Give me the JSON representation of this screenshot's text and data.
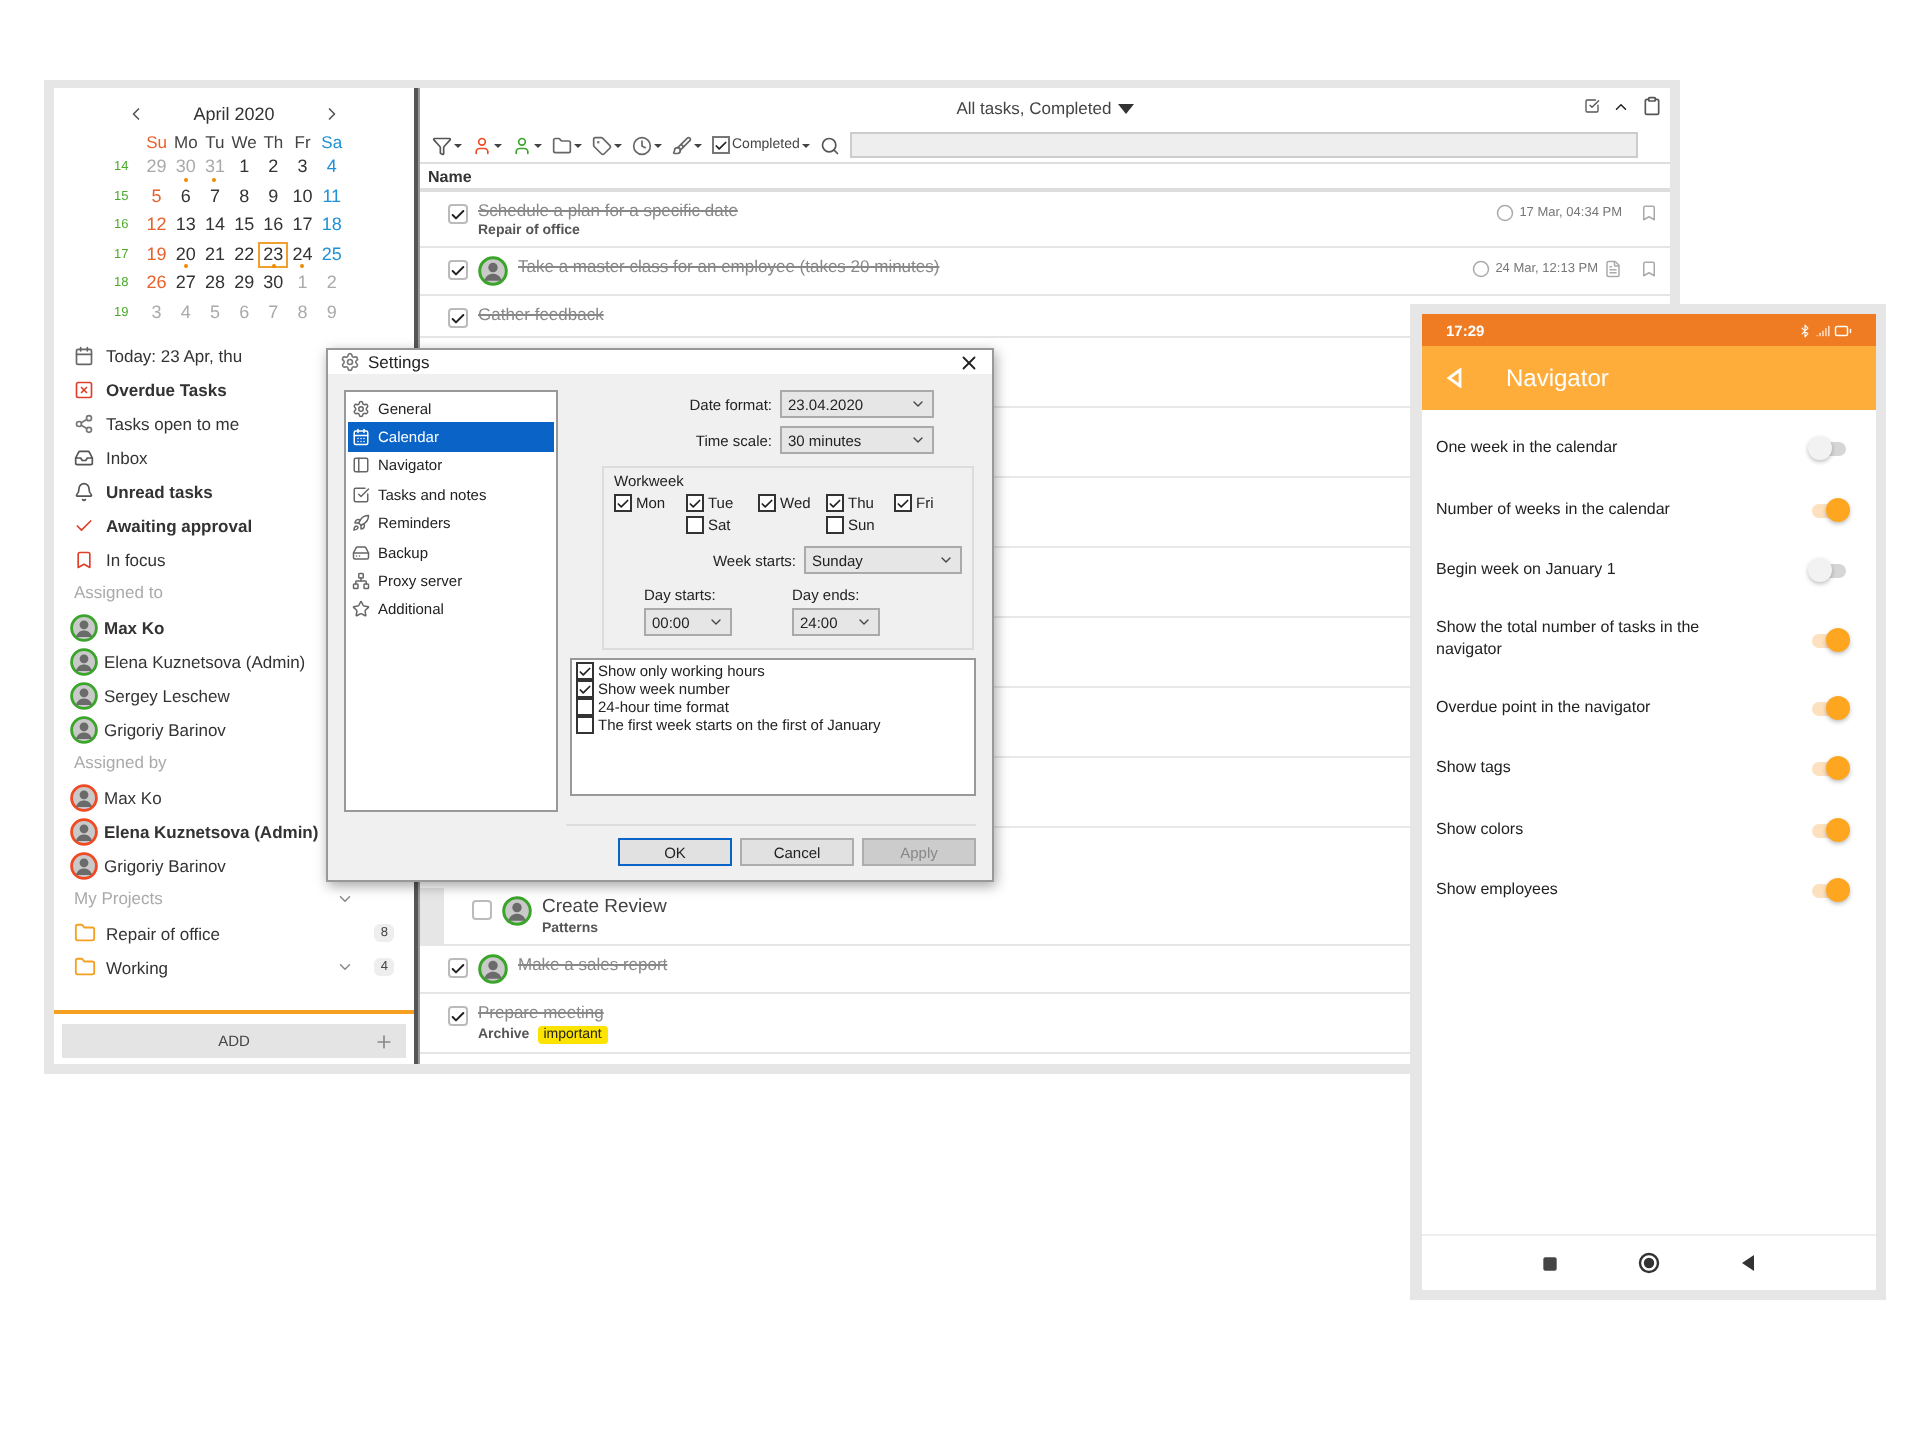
{
  "calendar": {
    "month": "April 2020",
    "weekdays": [
      "Su",
      "Mo",
      "Tu",
      "We",
      "Th",
      "Fr",
      "Sa"
    ],
    "weeks": [
      {
        "number": "14",
        "days": [
          {
            "d": "29",
            "muted": true,
            "marked": false,
            "selected": false
          },
          {
            "d": "30",
            "muted": true,
            "marked": true,
            "selected": false
          },
          {
            "d": "31",
            "muted": true,
            "marked": true,
            "selected": false
          },
          {
            "d": "1",
            "muted": false,
            "marked": false,
            "selected": false
          },
          {
            "d": "2",
            "muted": false,
            "marked": false,
            "selected": false
          },
          {
            "d": "3",
            "muted": false,
            "marked": false,
            "selected": false
          },
          {
            "d": "4",
            "muted": false,
            "marked": false,
            "selected": false
          }
        ]
      },
      {
        "number": "15",
        "days": [
          {
            "d": "5",
            "muted": false,
            "marked": false,
            "selected": false
          },
          {
            "d": "6",
            "muted": false,
            "marked": false,
            "selected": false
          },
          {
            "d": "7",
            "muted": false,
            "marked": false,
            "selected": false
          },
          {
            "d": "8",
            "muted": false,
            "marked": false,
            "selected": false
          },
          {
            "d": "9",
            "muted": false,
            "marked": false,
            "selected": false
          },
          {
            "d": "10",
            "muted": false,
            "marked": false,
            "selected": false
          },
          {
            "d": "11",
            "muted": false,
            "marked": false,
            "selected": false
          }
        ]
      },
      {
        "number": "16",
        "days": [
          {
            "d": "12",
            "muted": false,
            "marked": false,
            "selected": false
          },
          {
            "d": "13",
            "muted": false,
            "marked": false,
            "selected": false
          },
          {
            "d": "14",
            "muted": false,
            "marked": false,
            "selected": false
          },
          {
            "d": "15",
            "muted": false,
            "marked": false,
            "selected": false
          },
          {
            "d": "16",
            "muted": false,
            "marked": false,
            "selected": false
          },
          {
            "d": "17",
            "muted": false,
            "marked": false,
            "selected": false
          },
          {
            "d": "18",
            "muted": false,
            "marked": false,
            "selected": false
          }
        ]
      },
      {
        "number": "17",
        "days": [
          {
            "d": "19",
            "muted": false,
            "marked": false,
            "selected": false
          },
          {
            "d": "20",
            "muted": false,
            "marked": true,
            "selected": false
          },
          {
            "d": "21",
            "muted": false,
            "marked": false,
            "selected": false
          },
          {
            "d": "22",
            "muted": false,
            "marked": false,
            "selected": false
          },
          {
            "d": "23",
            "muted": false,
            "marked": true,
            "selected": true
          },
          {
            "d": "24",
            "muted": false,
            "marked": true,
            "selected": false
          },
          {
            "d": "25",
            "muted": false,
            "marked": false,
            "selected": false
          }
        ]
      },
      {
        "number": "18",
        "days": [
          {
            "d": "26",
            "muted": false,
            "marked": false,
            "selected": false
          },
          {
            "d": "27",
            "muted": false,
            "marked": false,
            "selected": false
          },
          {
            "d": "28",
            "muted": false,
            "marked": false,
            "selected": false
          },
          {
            "d": "29",
            "muted": false,
            "marked": false,
            "selected": false
          },
          {
            "d": "30",
            "muted": false,
            "marked": false,
            "selected": false
          },
          {
            "d": "1",
            "muted": true,
            "marked": false,
            "selected": false
          },
          {
            "d": "2",
            "muted": true,
            "marked": false,
            "selected": false
          }
        ]
      },
      {
        "number": "19",
        "days": [
          {
            "d": "3",
            "muted": true,
            "marked": false,
            "selected": false
          },
          {
            "d": "4",
            "muted": true,
            "marked": false,
            "selected": false
          },
          {
            "d": "5",
            "muted": true,
            "marked": false,
            "selected": false
          },
          {
            "d": "6",
            "muted": true,
            "marked": false,
            "selected": false
          },
          {
            "d": "7",
            "muted": true,
            "marked": false,
            "selected": false
          },
          {
            "d": "8",
            "muted": true,
            "marked": false,
            "selected": false
          },
          {
            "d": "9",
            "muted": true,
            "marked": false,
            "selected": false
          }
        ]
      }
    ]
  },
  "navigation": [
    {
      "label": "Today: 23 Apr, thu",
      "unread": false
    },
    {
      "label": "Overdue Tasks",
      "unread": true
    },
    {
      "label": "Tasks open to me",
      "unread": false
    },
    {
      "label": "Inbox",
      "unread": false
    },
    {
      "label": "Unread tasks",
      "unread": true
    },
    {
      "label": "Awaiting approval",
      "unread": true
    },
    {
      "label": "In focus",
      "unread": false
    }
  ],
  "assigned_to": {
    "heading": "Assigned to",
    "people": [
      {
        "name": "Max Ko",
        "unread": true
      },
      {
        "name": "Elena Kuznetsova (Admin)",
        "unread": false
      },
      {
        "name": "Sergey Leschew",
        "unread": false
      },
      {
        "name": "Grigoriy Barinov",
        "unread": false
      }
    ]
  },
  "assigned_by": {
    "heading": "Assigned by",
    "people": [
      {
        "name": "Max Ko",
        "unread": false
      },
      {
        "name": "Elena Kuznetsova (Admin)",
        "unread": true
      },
      {
        "name": "Grigoriy Barinov",
        "unread": false
      }
    ]
  },
  "projects": {
    "heading": "My Projects",
    "items": [
      {
        "name": "Repair of office",
        "count": "8",
        "expandable": false
      },
      {
        "name": "Working",
        "count": "4",
        "expandable": true
      }
    ]
  },
  "add_button": "ADD",
  "task_view": {
    "title": "All tasks, Completed",
    "status_filter": {
      "label": "Completed",
      "checked": true
    },
    "column": "Name",
    "tasks": [
      {
        "title": "Schedule a plan for a specific date",
        "done": true,
        "avatar": false,
        "project": "Repair of office",
        "date": "17 Mar, 04:34 PM",
        "attachment": false
      },
      {
        "title": "Take a master class for an employee (takes 20 minutes)",
        "done": true,
        "avatar": true,
        "date": "24 Mar, 12:13 PM",
        "attachment": true
      },
      {
        "title": "Gather feedback",
        "done": true,
        "avatar": false,
        "hidden_below": true
      },
      {
        "title": "Create Review",
        "done": false,
        "avatar": true,
        "project": "Patterns",
        "subtask": true
      },
      {
        "title": "Make a sales report",
        "done": true,
        "avatar": true
      },
      {
        "title": "Prepare meeting",
        "done": true,
        "avatar": false,
        "project": "Archive",
        "tag": "important"
      }
    ]
  },
  "settings_dialog": {
    "title": "Settings",
    "categories": [
      {
        "label": "General",
        "selected": false
      },
      {
        "label": "Calendar",
        "selected": true
      },
      {
        "label": "Navigator",
        "selected": false
      },
      {
        "label": "Tasks and notes",
        "selected": false
      },
      {
        "label": "Reminders",
        "selected": false
      },
      {
        "label": "Backup",
        "selected": false
      },
      {
        "label": "Proxy server",
        "selected": false
      },
      {
        "label": "Additional",
        "selected": false
      }
    ],
    "date_format": {
      "label": "Date format:",
      "value": "23.04.2020"
    },
    "time_scale": {
      "label": "Time scale:",
      "value": "30 minutes"
    },
    "workweek": {
      "heading": "Workweek",
      "days": [
        {
          "label": "Mon",
          "checked": true
        },
        {
          "label": "Tue",
          "checked": true
        },
        {
          "label": "Wed",
          "checked": true
        },
        {
          "label": "Thu",
          "checked": true
        },
        {
          "label": "Fri",
          "checked": true
        },
        {
          "label": "Sat",
          "checked": false
        },
        {
          "label": "Sun",
          "checked": false
        }
      ],
      "week_starts": {
        "label": "Week starts:",
        "value": "Sunday"
      },
      "day_starts": {
        "label": "Day starts:",
        "value": "00:00"
      },
      "day_ends": {
        "label": "Day ends:",
        "value": "24:00"
      }
    },
    "options": [
      {
        "label": "Show only working hours",
        "checked": true
      },
      {
        "label": "Show week number",
        "checked": true
      },
      {
        "label": "24-hour time format",
        "checked": false
      },
      {
        "label": "The first week starts on the first of January",
        "checked": false
      }
    ],
    "buttons": [
      {
        "label": "OK",
        "kind": "default"
      },
      {
        "label": "Cancel",
        "kind": "normal"
      },
      {
        "label": "Apply",
        "kind": "disabled"
      }
    ]
  },
  "phone": {
    "time": "17:29",
    "title": "Navigator",
    "settings": [
      {
        "label": "One week in the calendar",
        "on": false
      },
      {
        "label": "Number of weeks in the calendar",
        "on": true
      },
      {
        "label": "Begin week on January 1",
        "on": false
      },
      {
        "label": "Show the total number of tasks in the navigator",
        "on": true
      },
      {
        "label": "Overdue point in the navigator",
        "on": true
      },
      {
        "label": "Show tags",
        "on": true
      },
      {
        "label": "Show colors",
        "on": true
      },
      {
        "label": "Show employees",
        "on": true
      }
    ]
  }
}
